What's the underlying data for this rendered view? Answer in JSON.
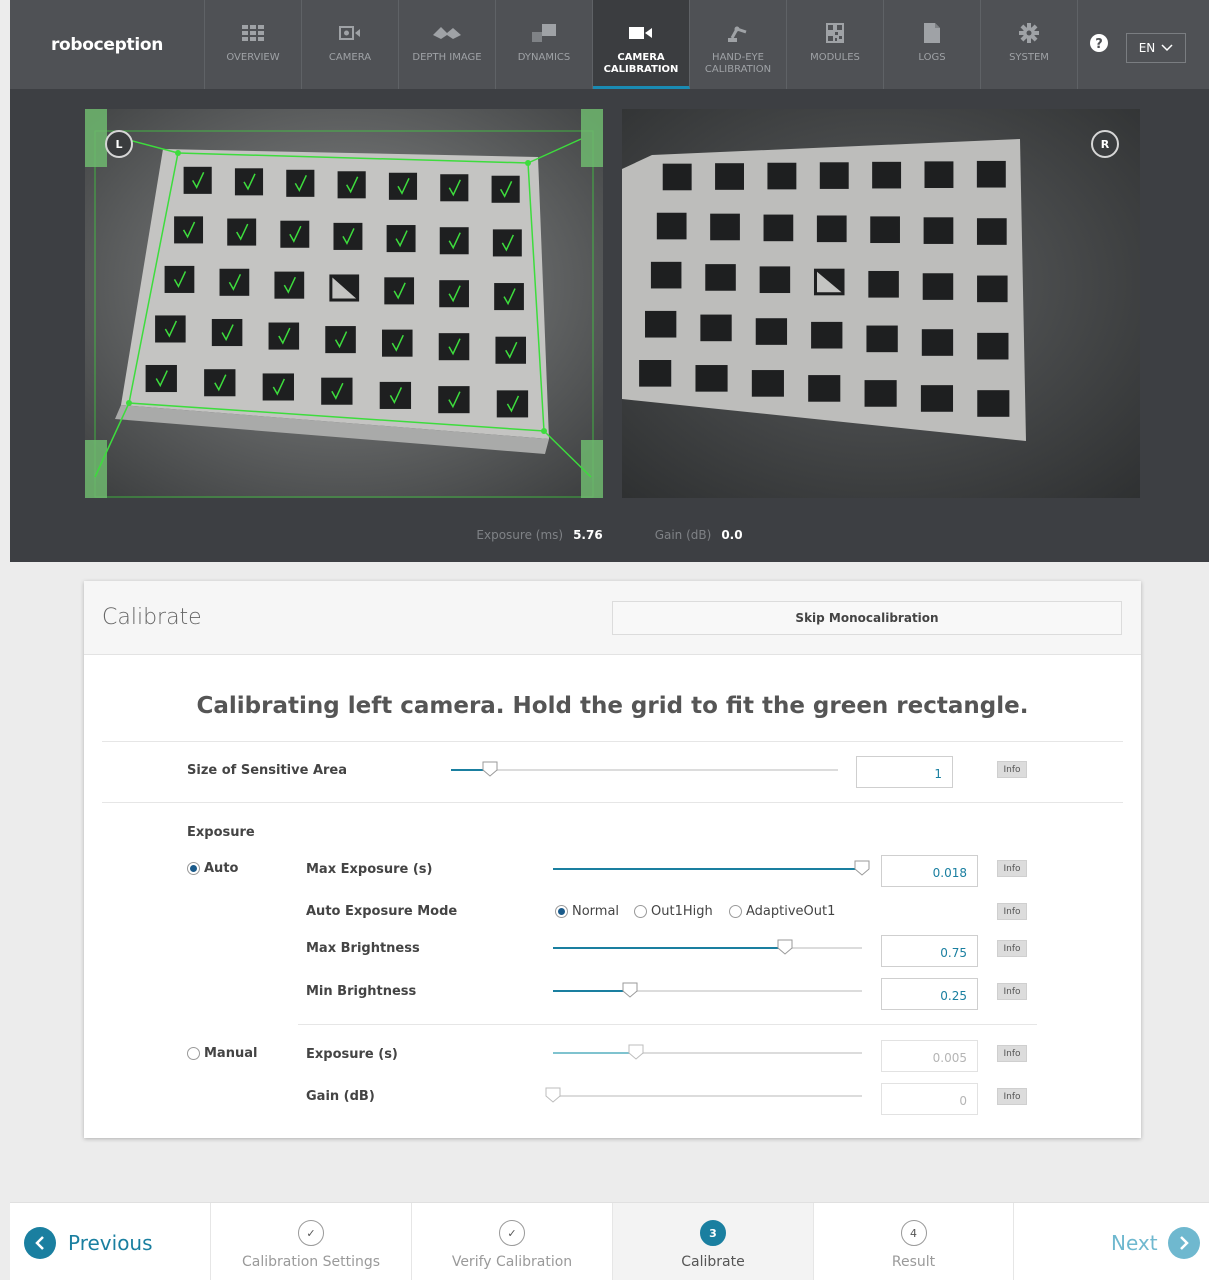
{
  "brand": "roboception",
  "nav": {
    "items": [
      {
        "label": "OVERVIEW",
        "icon": "grid-icon"
      },
      {
        "label": "CAMERA",
        "icon": "camera-icon"
      },
      {
        "label": "DEPTH IMAGE",
        "icon": "depth-icon"
      },
      {
        "label": "DYNAMICS",
        "icon": "dynamics-icon"
      },
      {
        "label": "CAMERA CALIBRATION",
        "icon": "video-camera-icon",
        "active": true
      },
      {
        "label": "HAND-EYE CALIBRATION",
        "icon": "robot-arm-icon"
      },
      {
        "label": "MODULES",
        "icon": "qr-icon"
      },
      {
        "label": "LOGS",
        "icon": "document-icon"
      },
      {
        "label": "SYSTEM",
        "icon": "gear-icon"
      }
    ],
    "language": "EN"
  },
  "camera": {
    "left_badge": "L",
    "right_badge": "R",
    "exposure_label": "Exposure (ms)",
    "exposure_value": "5.76",
    "gain_label": "Gain (dB)",
    "gain_value": "0.0"
  },
  "card": {
    "title": "Calibrate",
    "skip_button": "Skip Monocalibration",
    "instruction": "Calibrating left camera. Hold the grid to fit the green rectangle.",
    "info_label": "Info",
    "sensitive_area": {
      "label": "Size of Sensitive Area",
      "value": "1",
      "level": 0.1
    },
    "exposure_heading": "Exposure",
    "auto": {
      "label": "Auto",
      "selected": true,
      "max_exposure": {
        "label": "Max Exposure (s)",
        "value": "0.018",
        "level": 1.0
      },
      "mode": {
        "label": "Auto Exposure Mode",
        "options": [
          "Normal",
          "Out1High",
          "AdaptiveOut1"
        ],
        "selected": "Normal"
      },
      "max_brightness": {
        "label": "Max Brightness",
        "value": "0.75",
        "level": 0.75
      },
      "min_brightness": {
        "label": "Min Brightness",
        "value": "0.25",
        "level": 0.25
      }
    },
    "manual": {
      "label": "Manual",
      "selected": false,
      "exposure": {
        "label": "Exposure (s)",
        "value": "0.005",
        "level": 0.27
      },
      "gain": {
        "label": "Gain (dB)",
        "value": "0",
        "level": 0.0
      }
    }
  },
  "stepper": {
    "previous": "Previous",
    "next": "Next",
    "steps": [
      {
        "label": "Calibration Settings",
        "marker": "✓",
        "state": "done"
      },
      {
        "label": "Verify Calibration",
        "marker": "✓",
        "state": "done"
      },
      {
        "label": "Calibrate",
        "marker": "3",
        "state": "current"
      },
      {
        "label": "Result",
        "marker": "4",
        "state": "pending"
      }
    ]
  },
  "colors": {
    "accent": "#1a7fa0",
    "nav_bg": "#4f5155",
    "overlay_green": "#3ddc3d",
    "next_color": "#6fb8cf"
  }
}
